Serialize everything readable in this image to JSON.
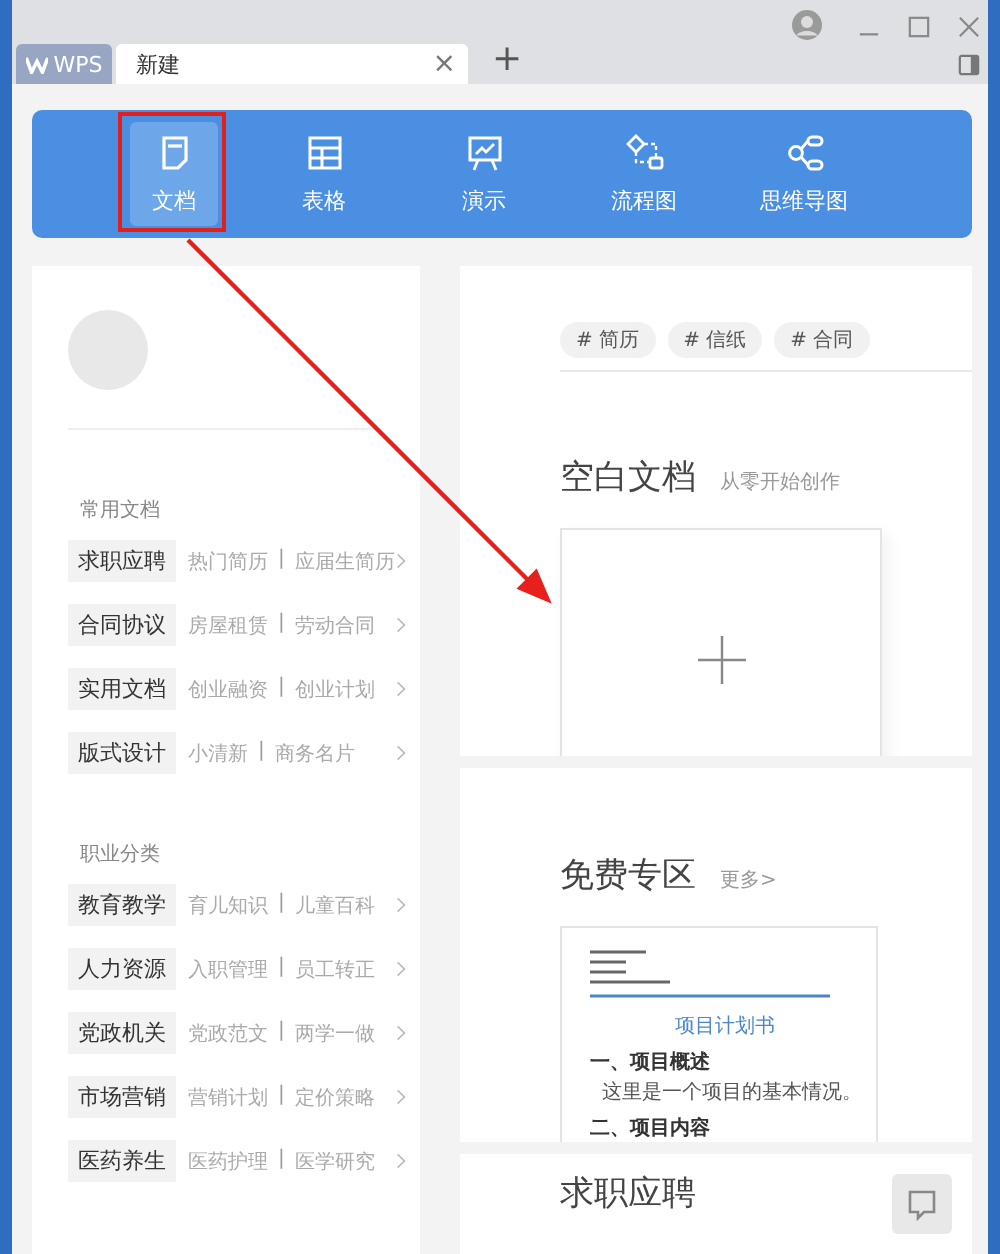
{
  "tabs": [
    {
      "label": "WPS",
      "kind": "home",
      "selected": false
    },
    {
      "label": "新建",
      "kind": "doc",
      "selected": true,
      "close": "×"
    }
  ],
  "new_tab": "+",
  "nav": [
    {
      "label": "文档",
      "kind": "doc",
      "selected": true,
      "highlighted": true
    },
    {
      "label": "表格",
      "kind": "table",
      "selected": false,
      "highlighted": false
    },
    {
      "label": "演示",
      "kind": "slide",
      "selected": false,
      "highlighted": false
    },
    {
      "label": "流程图",
      "kind": "flow",
      "selected": false,
      "highlighted": false
    },
    {
      "label": "思维导图",
      "kind": "mind",
      "selected": false,
      "highlighted": false
    }
  ],
  "sidebar": {
    "separator": "|",
    "groups": [
      {
        "title": "常用文档",
        "items": [
          {
            "label": "求职应聘",
            "links": [
              "热门简历",
              "应届生简历"
            ]
          },
          {
            "label": "合同协议",
            "links": [
              "房屋租赁",
              "劳动合同"
            ]
          },
          {
            "label": "实用文档",
            "links": [
              "创业融资",
              "创业计划"
            ]
          },
          {
            "label": "版式设计",
            "links": [
              "小清新",
              "商务名片"
            ]
          }
        ]
      },
      {
        "title": "职业分类",
        "items": [
          {
            "label": "教育教学",
            "links": [
              "育儿知识",
              "儿童百科"
            ]
          },
          {
            "label": "人力资源",
            "links": [
              "入职管理",
              "员工转正"
            ]
          },
          {
            "label": "党政机关",
            "links": [
              "党政范文",
              "两学一做"
            ]
          },
          {
            "label": "市场营销",
            "links": [
              "营销计划",
              "定价策略"
            ]
          },
          {
            "label": "医药养生",
            "links": [
              "医药护理",
              "医学研究"
            ]
          }
        ]
      }
    ]
  },
  "tags": [
    "# 简历",
    "# 信纸",
    "# 合同"
  ],
  "sections": [
    {
      "kind": "blank",
      "title": "空白文档",
      "subtitle": "从零开始创作"
    },
    {
      "kind": "free",
      "title": "免费专区",
      "subtitle": "更多>",
      "preview": {
        "heading": "项目计划书",
        "lines": [
          {
            "kind": "section",
            "text": "一、项目概述"
          },
          {
            "kind": "body",
            "text": "这里是一个项目的基本情况。"
          },
          {
            "kind": "section",
            "text": "二、项目内容"
          }
        ]
      }
    },
    {
      "kind": "heading",
      "title": "求职应聘"
    }
  ]
}
